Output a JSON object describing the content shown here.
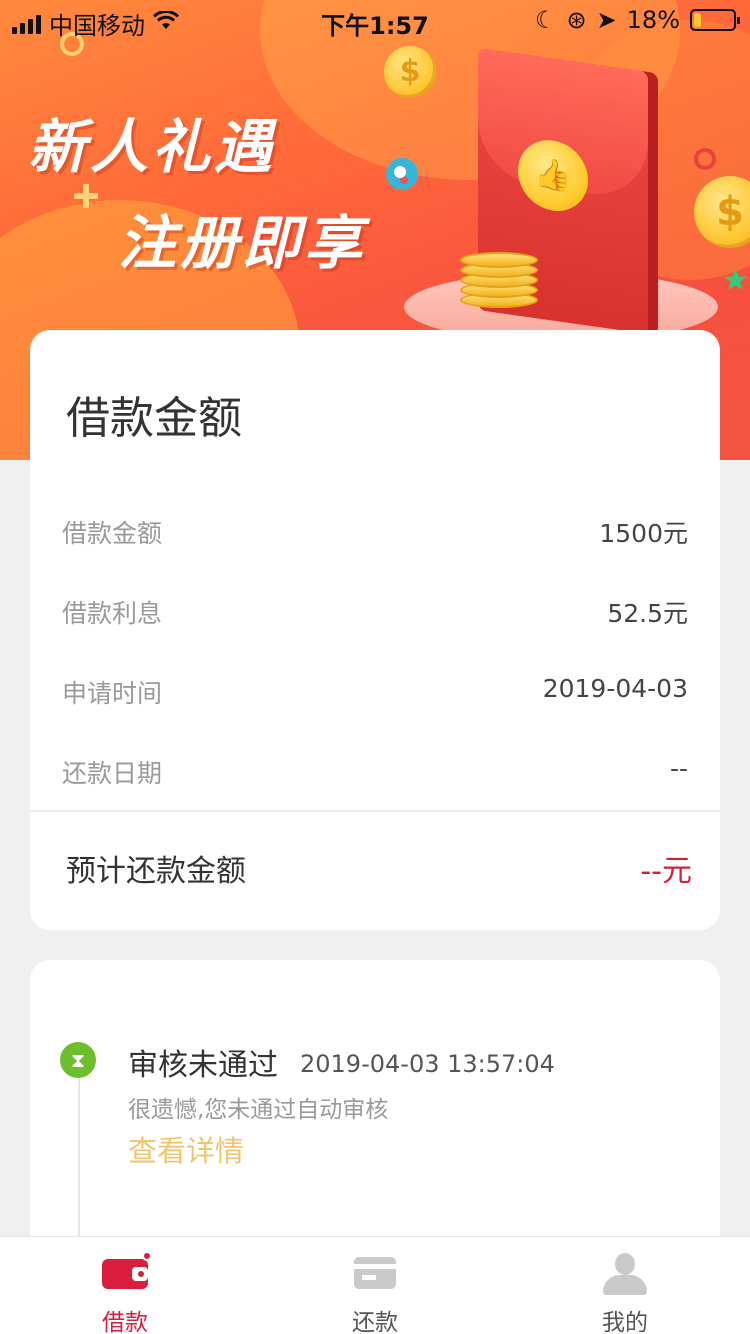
{
  "status_bar": {
    "carrier": "中国移动",
    "time": "下午1:57",
    "battery_percent": "18%",
    "battery_level": 0.18
  },
  "banner": {
    "line1": "新人礼遇",
    "line2": "注册即享"
  },
  "loan_card": {
    "title": "借款金额",
    "rows": [
      {
        "label": "借款金额",
        "value": "1500元"
      },
      {
        "label": "借款利息",
        "value": "52.5元"
      },
      {
        "label": "申请时间",
        "value": "2019-04-03"
      },
      {
        "label": "还款日期",
        "value": "--"
      }
    ],
    "total_label": "预计还款金额",
    "total_value": "--元"
  },
  "review": {
    "status": "审核未通过",
    "time": "2019-04-03 13:57:04",
    "description": "很遗憾,您未通过自动审核",
    "link": "查看详情"
  },
  "tabbar": {
    "tabs": [
      {
        "label": "借款",
        "icon": "wallet-icon",
        "active": true
      },
      {
        "label": "还款",
        "icon": "card-icon",
        "active": false
      },
      {
        "label": "我的",
        "icon": "user-icon",
        "active": false
      }
    ]
  },
  "colors": {
    "accent": "#d81e3c",
    "link": "#f1c46b",
    "status_ok": "#6cbf2a",
    "banner": "#f7503f"
  }
}
